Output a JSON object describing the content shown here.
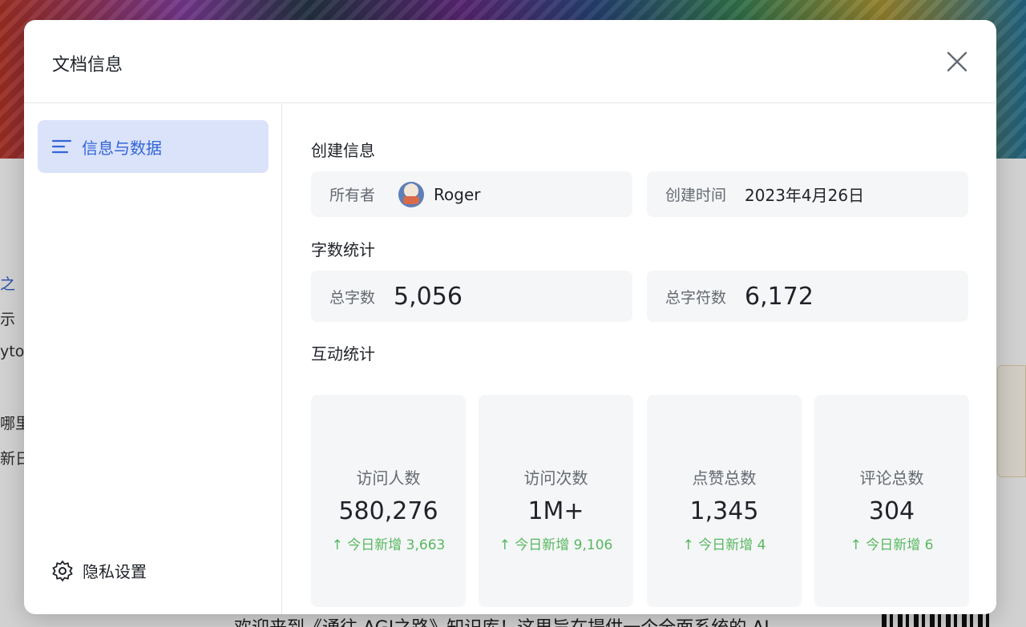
{
  "background": {
    "side_fragments": [
      "之",
      "示",
      "yto/",
      "哪里",
      "新日"
    ],
    "bottom_text": "欢迎来到《通往 AGI之路》知识库！这里旨在提供一个全面系统的 AI"
  },
  "modal": {
    "title": "文档信息",
    "close_icon": "close-icon"
  },
  "sidebar": {
    "nav_item": {
      "icon": "list-icon",
      "label": "信息与数据"
    },
    "privacy": {
      "icon": "gear-icon",
      "label": "隐私设置"
    }
  },
  "creation": {
    "title": "创建信息",
    "owner_label": "所有者",
    "owner_name": "Roger",
    "created_label": "创建时间",
    "created_value": "2023年4月26日"
  },
  "word_stats": {
    "title": "字数统计",
    "words_label": "总字数",
    "words_value": "5,056",
    "chars_label": "总字符数",
    "chars_value": "6,172"
  },
  "interaction": {
    "title": "互动统计",
    "cards": [
      {
        "label": "访问人数",
        "value": "580,276",
        "delta": "↑ 今日新增 3,663"
      },
      {
        "label": "访问次数",
        "value": "1M+",
        "delta": "↑ 今日新增 9,106"
      },
      {
        "label": "点赞总数",
        "value": "1,345",
        "delta": "↑ 今日新增 4"
      },
      {
        "label": "评论总数",
        "value": "304",
        "delta": "↑ 今日新增 6"
      }
    ]
  },
  "colors": {
    "accent": "#3366d6",
    "nav_active_bg": "#dbe3fb",
    "delta_green": "#57b860"
  }
}
